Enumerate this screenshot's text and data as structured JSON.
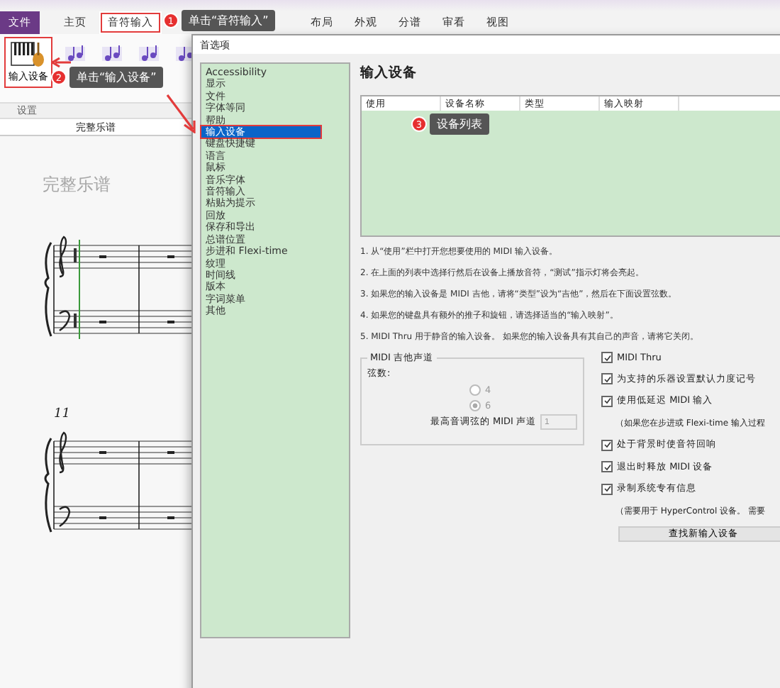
{
  "menu_tabs": [
    {
      "label": "文件",
      "kind": "file",
      "selected": false
    },
    {
      "label": "主页",
      "kind": "tab",
      "selected": false
    },
    {
      "label": "音符输入",
      "kind": "tab",
      "selected": true
    },
    {
      "label": "布局",
      "kind": "tab",
      "selected": false
    },
    {
      "label": "外观",
      "kind": "tab",
      "selected": false
    },
    {
      "label": "分谱",
      "kind": "tab",
      "selected": false
    },
    {
      "label": "审看",
      "kind": "tab",
      "selected": false
    },
    {
      "label": "视图",
      "kind": "tab",
      "selected": false
    }
  ],
  "ribbon": {
    "input_device_button": "输入设备",
    "group_label": "设置"
  },
  "document_tab": "完整乐谱",
  "score": {
    "title": "完整乐谱",
    "measure_number": "11"
  },
  "callouts": [
    {
      "number": "1",
      "text": "单击“音符输入”"
    },
    {
      "number": "2",
      "text": "单击“输入设备”"
    },
    {
      "number": "3",
      "text": "设备列表"
    }
  ],
  "dialog": {
    "title": "首选项",
    "categories": [
      {
        "label": "Accessibility",
        "selected": false
      },
      {
        "label": "显示",
        "selected": false
      },
      {
        "label": "文件",
        "selected": false
      },
      {
        "label": "字体等同",
        "selected": false
      },
      {
        "label": "帮助",
        "selected": false
      },
      {
        "label": "输入设备",
        "selected": true
      },
      {
        "label": "键盘快捷键",
        "selected": false
      },
      {
        "label": "语言",
        "selected": false
      },
      {
        "label": "鼠标",
        "selected": false
      },
      {
        "label": "音乐字体",
        "selected": false
      },
      {
        "label": "音符输入",
        "selected": false
      },
      {
        "label": "粘贴为提示",
        "selected": false
      },
      {
        "label": "回放",
        "selected": false
      },
      {
        "label": "保存和导出",
        "selected": false
      },
      {
        "label": "总谱位置",
        "selected": false
      },
      {
        "label": "步进和 Flexi-time",
        "selected": false
      },
      {
        "label": "纹理",
        "selected": false
      },
      {
        "label": "时间线",
        "selected": false
      },
      {
        "label": "版本",
        "selected": false
      },
      {
        "label": "字词菜单",
        "selected": false
      },
      {
        "label": "其他",
        "selected": false
      }
    ],
    "heading": "输入设备",
    "table_columns": [
      "使用",
      "设备名称",
      "类型",
      "输入映射"
    ],
    "instructions": [
      "1. 从“使用”栏中打开您想要使用的 MIDI 输入设备。",
      "2. 在上面的列表中选择行然后在设备上播放音符，“测试”指示灯将会亮起。",
      "3. 如果您的输入设备是 MIDI 吉他，请将“类型”设为“吉他”，然后在下面设置弦数。",
      "4. 如果您的键盘具有额外的推子和旋钮，请选择适当的“输入映射”。",
      "5. MIDI Thru 用于静音的输入设备。 如果您的输入设备具有其自己的声音，请将它关闭。"
    ],
    "guitar_group": {
      "title": "MIDI 吉他声道",
      "strings_label": "弦数:",
      "radios": [
        {
          "label": "4",
          "selected": false
        },
        {
          "label": "6",
          "selected": true
        }
      ],
      "channel_label": "最高音调弦的 MIDI 声道",
      "channel_value": "1"
    },
    "options": [
      {
        "kind": "checkbox",
        "label": "MIDI Thru",
        "checked": true
      },
      {
        "kind": "checkbox",
        "label": "为支持的乐器设置默认力度记号",
        "checked": true
      },
      {
        "kind": "checkbox",
        "label": "使用低延迟 MIDI 输入",
        "checked": true
      },
      {
        "kind": "note",
        "label": "（如果您在步进或 Flexi-time 输入过程"
      },
      {
        "kind": "checkbox",
        "label": "处于背景时使音符回响",
        "checked": true
      },
      {
        "kind": "checkbox",
        "label": "退出时释放 MIDI 设备",
        "checked": true
      },
      {
        "kind": "checkbox",
        "label": "录制系统专有信息",
        "checked": true
      },
      {
        "kind": "note",
        "label": "（需要用于 HyperControl 设备。 需要"
      },
      {
        "kind": "button",
        "label": "查找新输入设备"
      }
    ]
  }
}
